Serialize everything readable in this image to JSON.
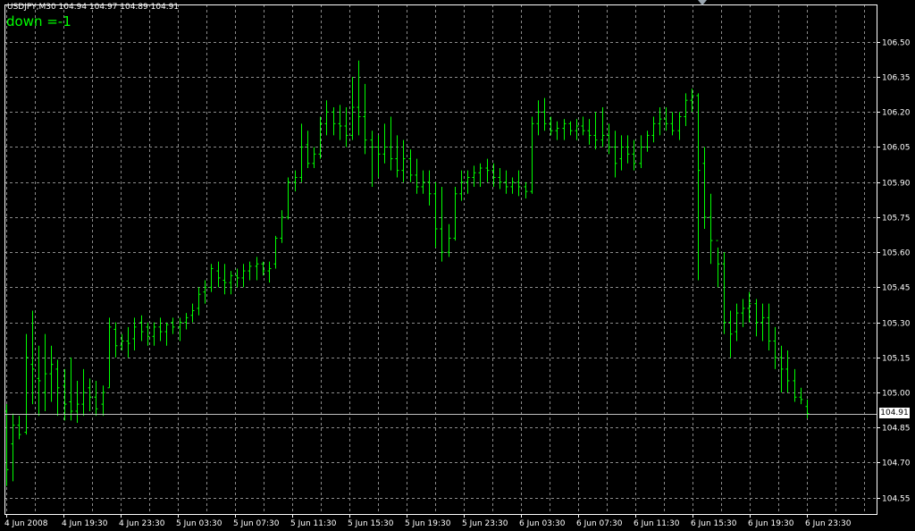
{
  "header": {
    "symbol_info": "USDJPY,M30  104.94 104.97 104.89 104.91",
    "indicator_text": "down =-1"
  },
  "colors": {
    "background": "#000000",
    "bars": "#00ff00",
    "grid": "#8c8c8c",
    "text": "#ffffff",
    "axis": "#ffffff"
  },
  "chart_data": {
    "type": "ohlc",
    "symbol": "USDJPY",
    "timeframe": "M30",
    "grid": true,
    "current_price": 104.91,
    "current_price_label": "104.91",
    "ylim": [
      104.48,
      106.66
    ],
    "y_ticks": [
      104.55,
      104.7,
      104.85,
      105.0,
      105.15,
      105.3,
      105.45,
      105.6,
      105.75,
      105.9,
      106.05,
      106.2,
      106.35,
      106.5
    ],
    "y_tick_labels": [
      "104.55",
      "104.70",
      "104.85",
      "105.00",
      "105.15",
      "105.30",
      "105.45",
      "105.60",
      "105.75",
      "105.90",
      "106.05",
      "106.20",
      "106.35",
      "106.50"
    ],
    "x_tick_labels": [
      "4 Jun 2008",
      "4 Jun 19:30",
      "4 Jun 23:30",
      "5 Jun 03:30",
      "5 Jun 07:30",
      "5 Jun 11:30",
      "5 Jun 15:30",
      "5 Jun 19:30",
      "5 Jun 23:30",
      "6 Jun 03:30",
      "6 Jun 07:30",
      "6 Jun 11:30",
      "6 Jun 15:30",
      "6 Jun 19:30",
      "6 Jun 23:30"
    ],
    "bar_interval_minutes": 30,
    "bars": [
      [
        104.92,
        104.95,
        104.6,
        104.67
      ],
      [
        104.78,
        104.91,
        104.62,
        104.86
      ],
      [
        104.86,
        104.9,
        104.8,
        104.82
      ],
      [
        104.83,
        105.25,
        104.82,
        105.15
      ],
      [
        105.12,
        105.35,
        104.95,
        105.1
      ],
      [
        105.06,
        105.2,
        104.9,
        105.05
      ],
      [
        105.0,
        105.25,
        104.92,
        105.08
      ],
      [
        105.08,
        105.2,
        104.96,
        105.12
      ],
      [
        105.1,
        105.14,
        104.9,
        105.02
      ],
      [
        105.03,
        105.1,
        104.88,
        104.95
      ],
      [
        104.96,
        105.15,
        104.88,
        104.92
      ],
      [
        104.92,
        105.05,
        104.87,
        104.95
      ],
      [
        104.95,
        105.1,
        104.9,
        105.0
      ],
      [
        105.02,
        105.06,
        104.92,
        104.98
      ],
      [
        104.98,
        105.05,
        104.9,
        104.93
      ],
      [
        104.95,
        105.03,
        104.9,
        105.0
      ],
      [
        105.02,
        105.32,
        105.02,
        105.28
      ],
      [
        105.27,
        105.3,
        105.15,
        105.2
      ],
      [
        105.2,
        105.25,
        105.18,
        105.22
      ],
      [
        105.22,
        105.28,
        105.15,
        105.21
      ],
      [
        105.23,
        105.32,
        105.18,
        105.28
      ],
      [
        105.3,
        105.33,
        105.22,
        105.26
      ],
      [
        105.28,
        105.3,
        105.2,
        105.24
      ],
      [
        105.24,
        105.3,
        105.2,
        105.28
      ],
      [
        105.28,
        105.32,
        105.22,
        105.26
      ],
      [
        105.26,
        105.3,
        105.2,
        105.29
      ],
      [
        105.3,
        105.32,
        105.25,
        105.28
      ],
      [
        105.28,
        105.32,
        105.22,
        105.3
      ],
      [
        105.3,
        105.34,
        105.27,
        105.32
      ],
      [
        105.33,
        105.38,
        105.3,
        105.35
      ],
      [
        105.36,
        105.45,
        105.33,
        105.42
      ],
      [
        105.43,
        105.48,
        105.38,
        105.45
      ],
      [
        105.45,
        105.55,
        105.43,
        105.53
      ],
      [
        105.52,
        105.56,
        105.45,
        105.49
      ],
      [
        105.48,
        105.55,
        105.42,
        105.47
      ],
      [
        105.47,
        105.52,
        105.42,
        105.5
      ],
      [
        105.5,
        105.53,
        105.45,
        105.49
      ],
      [
        105.49,
        105.55,
        105.45,
        105.52
      ],
      [
        105.52,
        105.56,
        105.48,
        105.54
      ],
      [
        105.54,
        105.58,
        105.48,
        105.55
      ],
      [
        105.55,
        105.56,
        105.5,
        105.52
      ],
      [
        105.52,
        105.56,
        105.47,
        105.53
      ],
      [
        105.55,
        105.67,
        105.53,
        105.66
      ],
      [
        105.66,
        105.78,
        105.64,
        105.75
      ],
      [
        105.75,
        105.92,
        105.74,
        105.9
      ],
      [
        105.9,
        105.95,
        105.86,
        105.92
      ],
      [
        105.92,
        106.15,
        105.9,
        106.05
      ],
      [
        106.06,
        106.12,
        105.96,
        105.98
      ],
      [
        105.98,
        106.05,
        105.96,
        106.02
      ],
      [
        106.02,
        106.18,
        106.0,
        106.15
      ],
      [
        106.15,
        106.25,
        106.1,
        106.2
      ],
      [
        106.2,
        106.22,
        106.1,
        106.15
      ],
      [
        106.15,
        106.23,
        106.08,
        106.14
      ],
      [
        106.14,
        106.22,
        106.05,
        106.1
      ],
      [
        106.1,
        106.35,
        106.08,
        106.22
      ],
      [
        106.22,
        106.42,
        106.1,
        106.18
      ],
      [
        106.18,
        106.32,
        106.02,
        106.08
      ],
      [
        106.08,
        106.12,
        105.88,
        106.05
      ],
      [
        106.05,
        106.1,
        105.92,
        106.02
      ],
      [
        106.02,
        106.15,
        105.98,
        106.05
      ],
      [
        106.05,
        106.18,
        105.95,
        106.0
      ],
      [
        106.0,
        106.1,
        105.92,
        105.95
      ],
      [
        105.95,
        106.08,
        105.9,
        106.0
      ],
      [
        106.0,
        106.04,
        105.9,
        105.93
      ],
      [
        105.93,
        106.0,
        105.85,
        105.88
      ],
      [
        105.88,
        105.95,
        105.85,
        105.9
      ],
      [
        105.9,
        105.95,
        105.8,
        105.85
      ],
      [
        105.85,
        105.9,
        105.62,
        105.7
      ],
      [
        105.7,
        105.88,
        105.56,
        105.6
      ],
      [
        105.6,
        105.72,
        105.58,
        105.66
      ],
      [
        105.66,
        105.88,
        105.65,
        105.85
      ],
      [
        105.85,
        105.95,
        105.82,
        105.9
      ],
      [
        105.9,
        105.95,
        105.85,
        105.92
      ],
      [
        105.92,
        105.97,
        105.88,
        105.94
      ],
      [
        105.94,
        105.98,
        105.88,
        105.96
      ],
      [
        105.96,
        106.0,
        105.9,
        105.95
      ],
      [
        105.95,
        105.98,
        105.88,
        105.92
      ],
      [
        105.92,
        105.96,
        105.87,
        105.9
      ],
      [
        105.9,
        105.95,
        105.85,
        105.88
      ],
      [
        105.88,
        105.92,
        105.85,
        105.9
      ],
      [
        105.9,
        105.95,
        105.84,
        105.88
      ],
      [
        105.88,
        105.9,
        105.83,
        105.86
      ],
      [
        105.86,
        106.18,
        105.85,
        106.15
      ],
      [
        106.15,
        106.25,
        106.1,
        106.2
      ],
      [
        106.2,
        106.26,
        106.12,
        106.15
      ],
      [
        106.15,
        106.18,
        106.1,
        106.12
      ],
      [
        106.12,
        106.16,
        106.08,
        106.13
      ],
      [
        106.13,
        106.17,
        106.08,
        106.15
      ],
      [
        106.15,
        106.16,
        106.1,
        106.12
      ],
      [
        106.12,
        106.17,
        106.08,
        106.14
      ],
      [
        106.14,
        106.18,
        106.1,
        106.12
      ],
      [
        106.12,
        106.17,
        106.06,
        106.1
      ],
      [
        106.1,
        106.2,
        106.04,
        106.08
      ],
      [
        106.08,
        106.22,
        106.05,
        106.1
      ],
      [
        106.1,
        106.15,
        106.02,
        106.05
      ],
      [
        106.05,
        106.12,
        105.92,
        105.98
      ],
      [
        106.0,
        106.1,
        105.95,
        106.05
      ],
      [
        106.05,
        106.1,
        105.98,
        106.02
      ],
      [
        106.02,
        106.08,
        105.95,
        105.98
      ],
      [
        105.98,
        106.1,
        105.96,
        106.05
      ],
      [
        106.05,
        106.12,
        106.03,
        106.1
      ],
      [
        106.1,
        106.18,
        106.07,
        106.15
      ],
      [
        106.15,
        106.22,
        106.1,
        106.17
      ],
      [
        106.17,
        106.22,
        106.12,
        106.15
      ],
      [
        106.15,
        106.2,
        106.1,
        106.12
      ],
      [
        106.12,
        106.2,
        106.08,
        106.18
      ],
      [
        106.18,
        106.28,
        106.14,
        106.25
      ],
      [
        106.25,
        106.3,
        106.2,
        106.27
      ],
      [
        106.27,
        106.28,
        105.48,
        105.95
      ],
      [
        105.98,
        106.05,
        105.7,
        105.75
      ],
      [
        105.75,
        105.85,
        105.55,
        105.65
      ],
      [
        105.65,
        105.62,
        105.45,
        105.55
      ],
      [
        105.55,
        105.6,
        105.25,
        105.3
      ],
      [
        105.3,
        105.35,
        105.15,
        105.25
      ],
      [
        105.26,
        105.38,
        105.22,
        105.34
      ],
      [
        105.34,
        105.4,
        105.28,
        105.36
      ],
      [
        105.36,
        105.43,
        105.3,
        105.38
      ],
      [
        105.38,
        105.4,
        105.24,
        105.3
      ],
      [
        105.3,
        105.38,
        105.22,
        105.32
      ],
      [
        105.32,
        105.38,
        105.18,
        105.22
      ],
      [
        105.22,
        105.28,
        105.1,
        105.15
      ],
      [
        105.15,
        105.2,
        105.0,
        105.1
      ],
      [
        105.1,
        105.18,
        105.0,
        105.05
      ],
      [
        105.05,
        105.1,
        104.96,
        104.98
      ],
      [
        104.98,
        105.02,
        104.95,
        104.97
      ],
      [
        104.94,
        104.97,
        104.89,
        104.91
      ]
    ]
  }
}
